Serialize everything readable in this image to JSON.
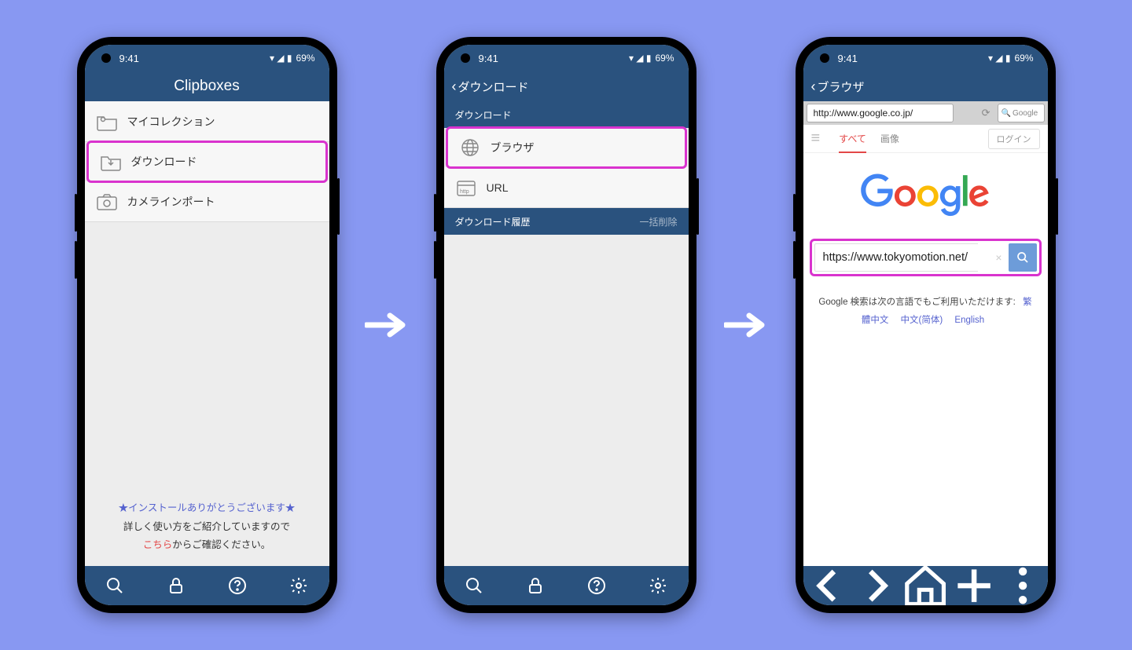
{
  "status": {
    "time": "9:41",
    "battery": "69%"
  },
  "screen1": {
    "title": "Clipboxes",
    "items": [
      {
        "label": "マイコレクション"
      },
      {
        "label": "ダウンロード"
      },
      {
        "label": "カメラインポート"
      }
    ],
    "footer": {
      "thank_you": "★インストールありがとうございます★",
      "detail_pre": "詳しく使い方をご紹介していますので",
      "link": "こちら",
      "detail_post": "からご確認ください。"
    }
  },
  "screen2": {
    "header": "ダウンロード",
    "section_dl": "ダウンロード",
    "items": [
      {
        "label": "ブラウザ"
      },
      {
        "label": "URL"
      }
    ],
    "section_history": "ダウンロード履歴",
    "bulk_delete": "一括削除"
  },
  "screen3": {
    "header": "ブラウザ",
    "url": "http://www.google.co.jp/",
    "search_placeholder": "Google",
    "tabs": {
      "all": "すべて",
      "images": "画像",
      "login": "ログイン"
    },
    "search_value": "https://www.tokyomotion.net/",
    "lang_intro": "Google 検索は次の言語でもご利用いただけます:",
    "langs": [
      "繁體中文",
      "中文(简体)",
      "English"
    ]
  }
}
